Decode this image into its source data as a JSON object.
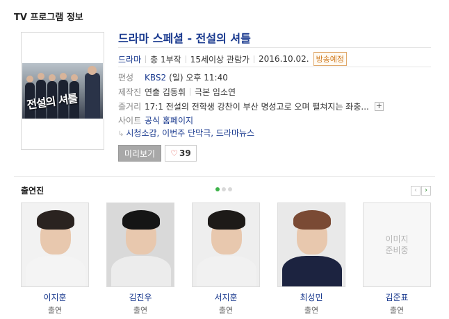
{
  "section_title": "TV 프로그램 정보",
  "program": {
    "title": "드라마 스페셜 - 전설의 셔틀",
    "poster_logo": "전설의 셔틀",
    "genre": "드라마",
    "episodes": "총 1부작",
    "rating": "15세이상 관람가",
    "date": "2016.10.02.",
    "badge": "방송예정",
    "schedule_label": "편성",
    "schedule_channel": "KBS2",
    "schedule_time": "(일) 오후 11:40",
    "staff_label": "제작진",
    "director": "연출 김동휘",
    "writer": "극본 임소연",
    "synopsis_label": "줄거리",
    "synopsis": "17:1 전설의 전학생 강찬이 부산 명성고로 오며 펼쳐지는 좌충...",
    "site_label": "사이트",
    "site_link": "공식 홈페이지",
    "related": "시청소감, 이번주 단막극, 드라마뉴스",
    "preview_button": "미리보기",
    "like_count": "39"
  },
  "cast_section": {
    "title": "출연진",
    "members": [
      {
        "name": "이지훈",
        "role": "출연",
        "hair": "#2a2320",
        "outfit": "#f4f4f4",
        "bg": "#f2f2f2"
      },
      {
        "name": "김진우",
        "role": "출연",
        "hair": "#151515",
        "outfit": "#ececec",
        "bg": "#d9d9d9"
      },
      {
        "name": "서지훈",
        "role": "출연",
        "hair": "#1d1a18",
        "outfit": "#f1f1f1",
        "bg": "#eeeeee"
      },
      {
        "name": "최성민",
        "role": "출연",
        "hair": "#7a4a34",
        "outfit": "#1c2340",
        "bg": "#e9e9e9"
      },
      {
        "name": "김준표",
        "role": "출연",
        "noimg": "이미지\n준비중"
      }
    ]
  },
  "colors": {
    "accent": "#1a3a8f",
    "badge": "#d07a1f",
    "dot_active": "#3db34a"
  }
}
